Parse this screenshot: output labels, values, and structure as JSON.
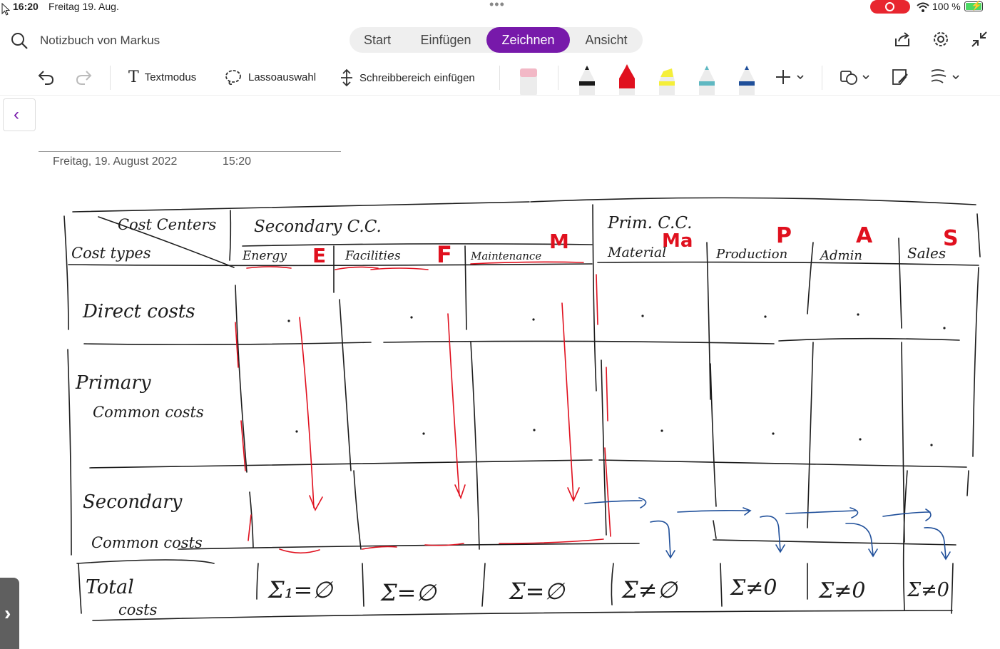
{
  "status": {
    "time": "16:20",
    "date": "Freitag 19. Aug.",
    "battery": "100 %"
  },
  "header": {
    "notebook_title": "Notizbuch von Markus",
    "tabs": [
      {
        "label": "Start",
        "active": false
      },
      {
        "label": "Einfügen",
        "active": false
      },
      {
        "label": "Zeichnen",
        "active": true
      },
      {
        "label": "Ansicht",
        "active": false
      }
    ]
  },
  "toolbar": {
    "text_mode": "Textmodus",
    "lasso": "Lassoauswahl",
    "insert_space": "Schreibbereich einfügen",
    "pens": [
      {
        "name": "eraser",
        "color": "#f2b8c6"
      },
      {
        "name": "black-pen",
        "color": "#1a1a1a"
      },
      {
        "name": "red-pen",
        "color": "#e0101e"
      },
      {
        "name": "yellow-highlighter",
        "color": "#f5ef3a"
      },
      {
        "name": "teal-pencil",
        "color": "#5fb8c2"
      },
      {
        "name": "blue-pen",
        "color": "#1f4f9a"
      }
    ],
    "accent": "#7719aa"
  },
  "page": {
    "date": "Freitag, 19. August 2022",
    "time": "15:20"
  },
  "sketch": {
    "corner_top": "Cost Centers",
    "corner_bottom": "Cost types",
    "secondary_header": "Secondary C.C.",
    "primary_header": "Prim. C.C.",
    "columns": [
      {
        "name": "Energy",
        "label": "E"
      },
      {
        "name": "Facilities",
        "label": "F"
      },
      {
        "name": "Maintenance",
        "label": "M"
      },
      {
        "name": "Material",
        "label": "Ma"
      },
      {
        "name": "Production",
        "label": "P"
      },
      {
        "name": "Admin",
        "label": "A"
      },
      {
        "name": "Sales",
        "label": "S"
      }
    ],
    "rows": {
      "direct": "Direct costs",
      "primary_1": "Primary",
      "primary_2": "Common costs",
      "secondary_1": "Secondary",
      "secondary_2": "Common costs",
      "total_1": "Total",
      "total_2": "costs"
    },
    "totals": [
      "Σ₁=∅",
      "Σ=∅",
      "Σ=∅",
      "Σ≠∅",
      "Σ≠0",
      "Σ≠0",
      "Σ≠0"
    ]
  }
}
